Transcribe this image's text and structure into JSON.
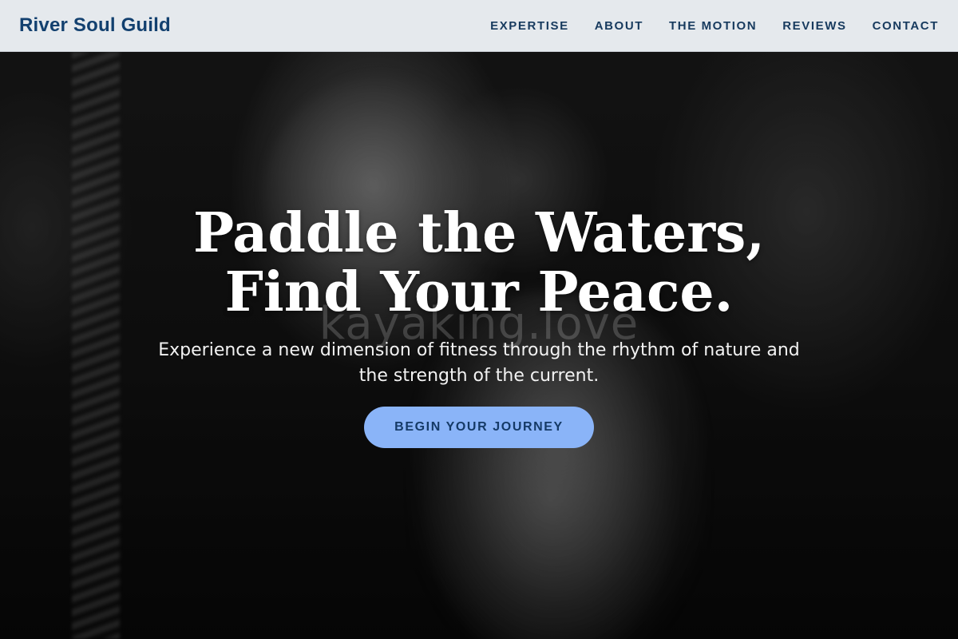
{
  "header": {
    "brand": "River Soul Guild",
    "nav": [
      "EXPERTISE",
      "ABOUT",
      "THE MOTION",
      "REVIEWS",
      "CONTACT"
    ]
  },
  "hero": {
    "headline": "Paddle the Waters, Find Your Peace.",
    "watermark": "kayaking.love",
    "subhead": "Experience a new dimension of fitness through the rhythm of nature and the strength of the current.",
    "cta_label": "BEGIN YOUR JOURNEY"
  },
  "colors": {
    "header_bg": "#e5e9ed",
    "brand_text": "#12406f",
    "cta_bg": "#8ab4f8",
    "cta_text": "#153a66"
  }
}
